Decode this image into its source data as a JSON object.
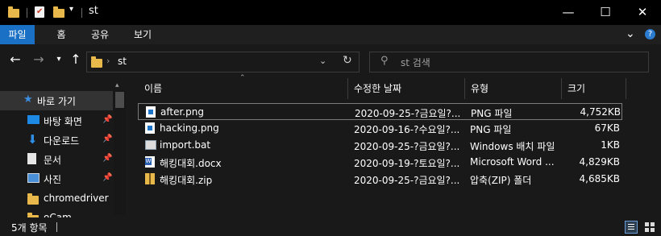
{
  "window": {
    "title": "st",
    "minimize": "—",
    "maximize": "☐",
    "close": "✕"
  },
  "ribbon": {
    "tabs": [
      {
        "label": "파일"
      },
      {
        "label": "홈"
      },
      {
        "label": "공유"
      },
      {
        "label": "보기"
      }
    ],
    "expand": "⌄",
    "help": "?"
  },
  "address": {
    "path": "st",
    "refresh": "↻"
  },
  "search": {
    "placeholder": "st 검색"
  },
  "nav": {
    "items": [
      {
        "label": "바로 가기"
      },
      {
        "label": "바탕 화면"
      },
      {
        "label": "다운로드"
      },
      {
        "label": "문서"
      },
      {
        "label": "사진"
      },
      {
        "label": "chromedriver"
      },
      {
        "label": "oCam"
      }
    ]
  },
  "columns": {
    "name": "이름",
    "date": "수정한 날짜",
    "type": "유형",
    "size": "크기"
  },
  "files": [
    {
      "name": "after.png",
      "date": "2020-09-25-?금요일?...",
      "type": "PNG 파일",
      "size": "4,752KB",
      "icon": "png-icon"
    },
    {
      "name": "hacking.png",
      "date": "2020-09-16-?수요일?...",
      "type": "PNG 파일",
      "size": "67KB",
      "icon": "png-icon"
    },
    {
      "name": "import.bat",
      "date": "2020-09-25-?금요일?...",
      "type": "Windows 배치 파일",
      "size": "1KB",
      "icon": "bat-icon"
    },
    {
      "name": "해킹대회.docx",
      "date": "2020-09-19-?토요일?...",
      "type": "Microsoft Word ...",
      "size": "4,829KB",
      "icon": "word-icon"
    },
    {
      "name": "해킹대회.zip",
      "date": "2020-09-25-?금요일?...",
      "type": "압축(ZIP) 폴더",
      "size": "4,685KB",
      "icon": "zip-icon"
    }
  ],
  "status": {
    "count": "5개 항목"
  }
}
